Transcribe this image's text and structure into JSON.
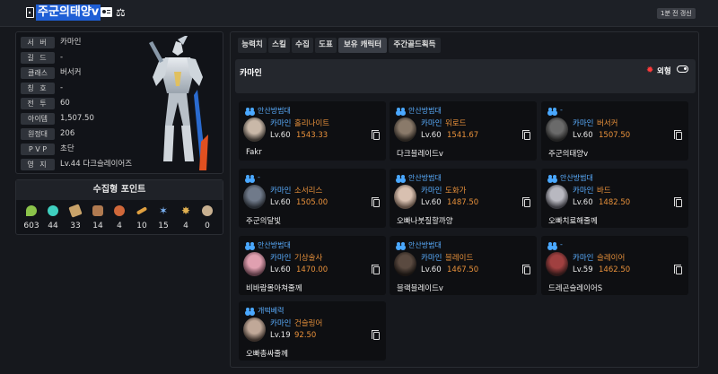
{
  "header": {
    "character_name": "주군의태양v",
    "refresh_label": "1분 전 갱신"
  },
  "profile": {
    "rows": [
      {
        "label": "서 버",
        "value": "카마인"
      },
      {
        "label": "길 드",
        "value": "-"
      },
      {
        "label": "클래스",
        "value": "버서커"
      },
      {
        "label": "칭 호",
        "value": "-"
      },
      {
        "label": "전 투",
        "value": "60"
      },
      {
        "label": "아이템",
        "value": "1,507.50"
      },
      {
        "label": "원정대",
        "value": "206"
      },
      {
        "label": "P V P",
        "value": "초단"
      },
      {
        "label": "영 지",
        "value": "Lv.44 다크슬레이어즈"
      }
    ]
  },
  "collection": {
    "title": "수집형 포인트",
    "items": [
      {
        "icon": "mokoko-seed-icon",
        "count": "603",
        "color": "#8bc34a"
      },
      {
        "icon": "island-heart-icon",
        "count": "44",
        "color": "#3fd0c0"
      },
      {
        "icon": "great-art-icon",
        "count": "33",
        "color": "#c9a36a"
      },
      {
        "icon": "giant-heart-icon",
        "count": "14",
        "color": "#b07a50"
      },
      {
        "icon": "ignea-token-icon",
        "count": "4",
        "color": "#d0683a"
      },
      {
        "icon": "sea-bounty-icon",
        "count": "10",
        "color": "#e0a040"
      },
      {
        "icon": "world-tree-leaf-icon",
        "count": "15",
        "color": "#7fb8ff"
      },
      {
        "icon": "orpheus-star-icon",
        "count": "4",
        "color": "#e0b050"
      },
      {
        "icon": "omnium-star-icon",
        "count": "0",
        "color": "#c8b090"
      }
    ]
  },
  "tabs": [
    {
      "label": "능력치"
    },
    {
      "label": "스킬"
    },
    {
      "label": "수집"
    },
    {
      "label": "도표"
    },
    {
      "label": "보유 캐릭터"
    },
    {
      "label": "주간골드획득"
    }
  ],
  "server_section": {
    "name": "카마인",
    "appearance_label": "외형"
  },
  "characters": [
    {
      "guild": "안산방범대",
      "server": "카마인",
      "class": "홀리나이트",
      "level": "Lv.60",
      "item_level": "1543.33",
      "nickname": "Fakr",
      "portrait": "#c9b8a8"
    },
    {
      "guild": "안산방범대",
      "server": "카마인",
      "class": "워로드",
      "level": "Lv.60",
      "item_level": "1541.67",
      "nickname": "다크블레이드v",
      "portrait": "#8a7a6a"
    },
    {
      "guild": "-",
      "server": "카마인",
      "class": "버서커",
      "level": "Lv.60",
      "item_level": "1507.50",
      "nickname": "주군의태양v",
      "portrait": "#6a6a6a"
    },
    {
      "guild": "-",
      "server": "카마인",
      "class": "소서리스",
      "level": "Lv.60",
      "item_level": "1505.00",
      "nickname": "주군의달빛",
      "portrait": "#707a8a"
    },
    {
      "guild": "안산방범대",
      "server": "카마인",
      "class": "도화가",
      "level": "Lv.60",
      "item_level": "1487.50",
      "nickname": "오빠나붓질할까양",
      "portrait": "#d8c0b0"
    },
    {
      "guild": "안산방범대",
      "server": "카마인",
      "class": "바드",
      "level": "Lv.60",
      "item_level": "1482.50",
      "nickname": "오빠치료해줄께",
      "portrait": "#b8b8c0"
    },
    {
      "guild": "안산방범대",
      "server": "카마인",
      "class": "기상술사",
      "level": "Lv.60",
      "item_level": "1470.00",
      "nickname": "비바람몰아쳐줄께",
      "portrait": "#e0a0b0"
    },
    {
      "guild": "안산방범대",
      "server": "카마인",
      "class": "블레이드",
      "level": "Lv.60",
      "item_level": "1467.50",
      "nickname": "블랙블레이드v",
      "portrait": "#5a4a40"
    },
    {
      "guild": "-",
      "server": "카마인",
      "class": "슬레이어",
      "level": "Lv.59",
      "item_level": "1462.50",
      "nickname": "드레곤슬레이어S",
      "portrait": "#a04040"
    },
    {
      "guild": "개떡베력",
      "server": "카마인",
      "class": "건슬링어",
      "level": "Lv.19",
      "item_level": "92.50",
      "nickname": "오빠총싸줄께",
      "portrait": "#c0a898"
    }
  ]
}
